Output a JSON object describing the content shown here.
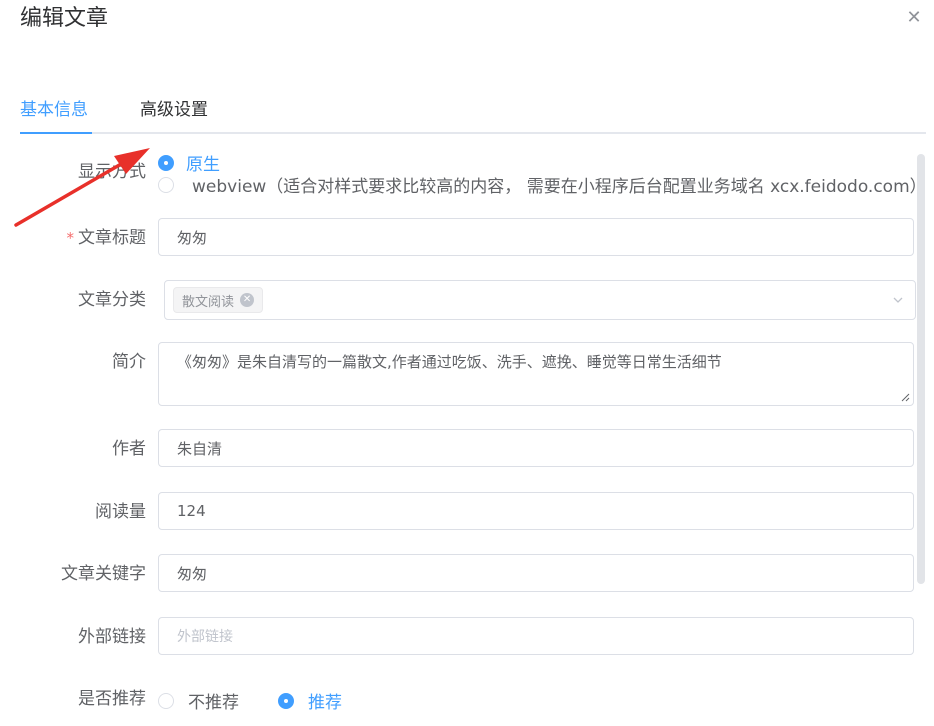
{
  "dialog": {
    "title": "编辑文章",
    "close_icon": "close-icon"
  },
  "tabs": [
    {
      "label": "基本信息",
      "active": true
    },
    {
      "label": "高级设置",
      "active": false
    }
  ],
  "form": {
    "display_mode": {
      "label": "显示方式",
      "options": [
        {
          "label": "原生",
          "checked": true
        },
        {
          "label": "webview（适合对样式要求比较高的内容， 需要在小程序后台配置业务域名 xcx.feidodo.com）",
          "checked": false
        }
      ]
    },
    "title": {
      "label": "文章标题",
      "required": true,
      "value": "匆匆"
    },
    "category": {
      "label": "文章分类",
      "tags": [
        "散文阅读"
      ]
    },
    "summary": {
      "label": "简介",
      "value": "《匆匆》是朱自清写的一篇散文,作者通过吃饭、洗手、遮挽、睡觉等日常生活细节"
    },
    "author": {
      "label": "作者",
      "value": "朱自清"
    },
    "read_count": {
      "label": "阅读量",
      "value": "124"
    },
    "keywords": {
      "label": "文章关键字",
      "value": "匆匆"
    },
    "external_link": {
      "label": "外部链接",
      "placeholder": "外部链接"
    },
    "recommend": {
      "label": "是否推荐",
      "options": [
        {
          "label": "不推荐",
          "checked": false
        },
        {
          "label": "推荐",
          "checked": true
        }
      ]
    }
  },
  "colors": {
    "accent": "#409eff",
    "annotation_arrow": "#e8302a",
    "required_mark": "#f56c6c"
  }
}
